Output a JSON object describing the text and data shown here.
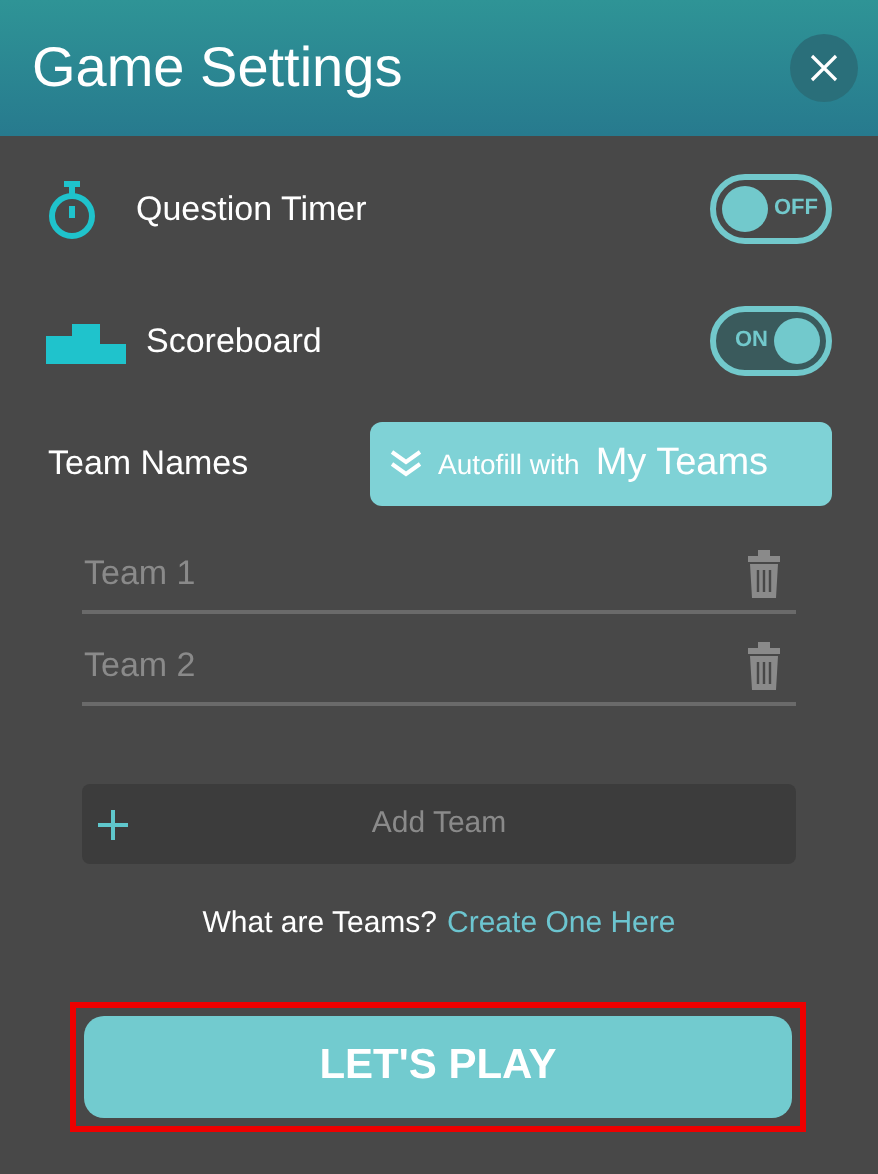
{
  "dialog": {
    "title": "Game Settings"
  },
  "settings": [
    {
      "kind": "timer",
      "label": "Question Timer",
      "on": false,
      "toggle_text": "OFF"
    },
    {
      "kind": "scoreboard",
      "label": "Scoreboard",
      "on": true,
      "toggle_text": "ON"
    }
  ],
  "team_names": {
    "label": "Team Names",
    "autofill_prefix": "Autofill with",
    "autofill_main": "My Teams"
  },
  "teams": [
    {
      "placeholder": "Team 1"
    },
    {
      "placeholder": "Team 2"
    }
  ],
  "add_team": "Add Team",
  "help": {
    "text": "What are Teams?",
    "link": "Create One Here"
  },
  "play_button": {
    "label": "LET'S PLAY",
    "highlighted": true
  }
}
